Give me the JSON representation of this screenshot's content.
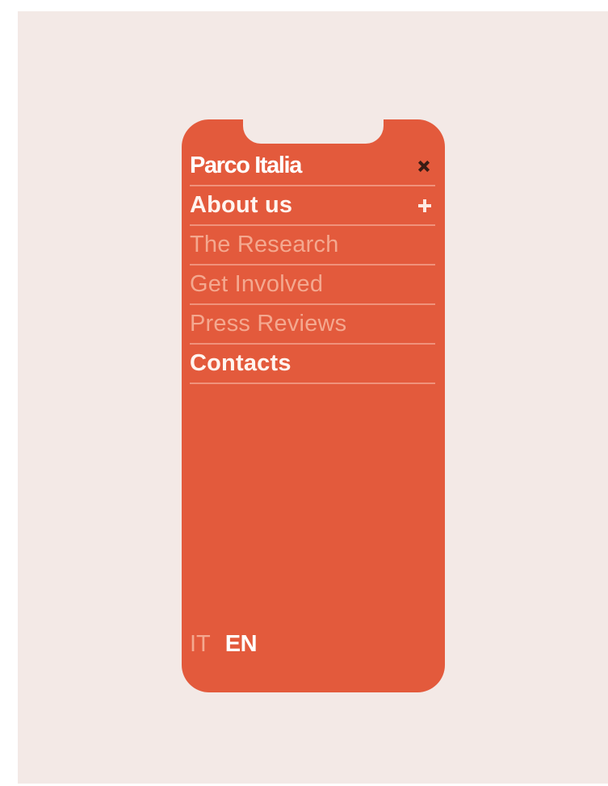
{
  "menu": {
    "brand": "Parco Italia",
    "close_icon": "close-icon",
    "items": [
      {
        "label": "About us",
        "state": "active",
        "icon": "plus-icon"
      },
      {
        "label": "The Research",
        "state": "inactive"
      },
      {
        "label": "Get Involved",
        "state": "inactive"
      },
      {
        "label": "Press Reviews",
        "state": "inactive"
      },
      {
        "label": "Contacts",
        "state": "active"
      }
    ]
  },
  "language": {
    "options": [
      "IT",
      "EN"
    ],
    "selected": "EN"
  },
  "colors": {
    "background": "#f3e9e6",
    "menu_background": "#e35a3c",
    "active_text": "#fff4ef",
    "inactive_text": "#f4a88f"
  }
}
